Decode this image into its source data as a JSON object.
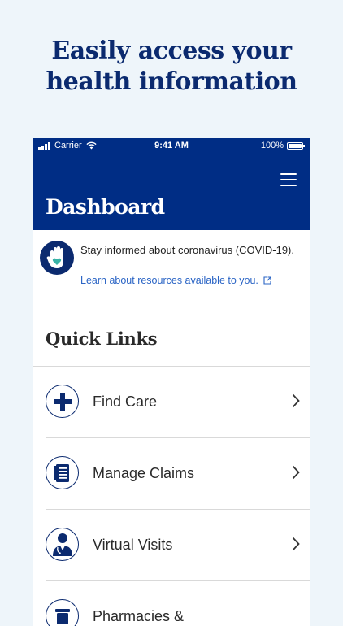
{
  "headline": {
    "line1": "Easily access your",
    "line2": "health information"
  },
  "status_bar": {
    "carrier": "Carrier",
    "time": "9:41 AM",
    "battery": "100%"
  },
  "header": {
    "title": "Dashboard"
  },
  "covid_banner": {
    "text": "Stay informed about coronavirus (COVID-19).",
    "link": "Learn about resources available to you."
  },
  "quick_links": {
    "title": "Quick Links",
    "items": [
      {
        "label": "Find Care",
        "icon": "plus-cross-icon"
      },
      {
        "label": "Manage Claims",
        "icon": "claims-document-icon"
      },
      {
        "label": "Virtual Visits",
        "icon": "doctor-icon"
      },
      {
        "label": "Pharmacies &",
        "icon": "pharmacy-icon"
      }
    ]
  },
  "colors": {
    "brand_navy": "#002d85",
    "headline": "#0b2a6f",
    "link": "#2a64c5",
    "background": "#eef5fa"
  }
}
